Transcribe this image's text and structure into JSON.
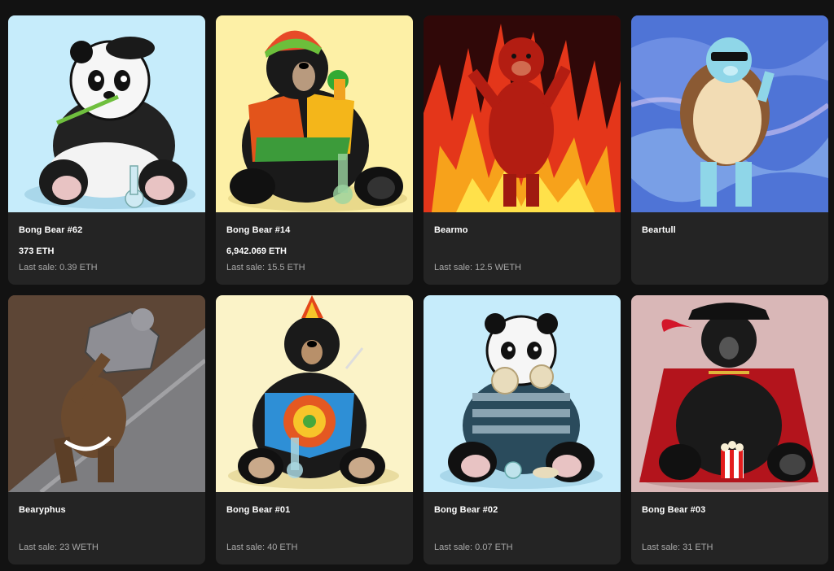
{
  "cards": [
    {
      "name": "Bong Bear #62",
      "price": "373 ETH",
      "last_sale": "Last sale: 0.39 ETH",
      "bg": "#c6ecfb",
      "subject": "panda-with-bong"
    },
    {
      "name": "Bong Bear #14",
      "price": "6,942.069 ETH",
      "last_sale": "Last sale: 15.5 ETH",
      "bg": "#fdf0a6",
      "subject": "black-bear-rasta-shirt"
    },
    {
      "name": "Bearmo",
      "price": "",
      "last_sale": "Last sale: 12.5 WETH",
      "bg": "#d9260f",
      "subject": "red-bear-in-flames"
    },
    {
      "name": "Beartull",
      "price": "",
      "last_sale": "",
      "bg": "#4f74d6",
      "subject": "blue-turtle-bear"
    },
    {
      "name": "Bearyphus",
      "price": "",
      "last_sale": "Last sale: 23 WETH",
      "bg": "#6a5040",
      "subject": "brown-bear-pushing-boulder"
    },
    {
      "name": "Bong Bear #01",
      "price": "",
      "last_sale": "Last sale: 40 ETH",
      "bg": "#fbf3c8",
      "subject": "black-bear-tie-dye"
    },
    {
      "name": "Bong Bear #02",
      "price": "",
      "last_sale": "Last sale: 0.07 ETH",
      "bg": "#c6ecfb",
      "subject": "panda-eating-tortilla"
    },
    {
      "name": "Bong Bear #03",
      "price": "",
      "last_sale": "Last sale: 31 ETH",
      "bg": "#d9b7b7",
      "subject": "black-bear-pirate-popcorn"
    }
  ]
}
